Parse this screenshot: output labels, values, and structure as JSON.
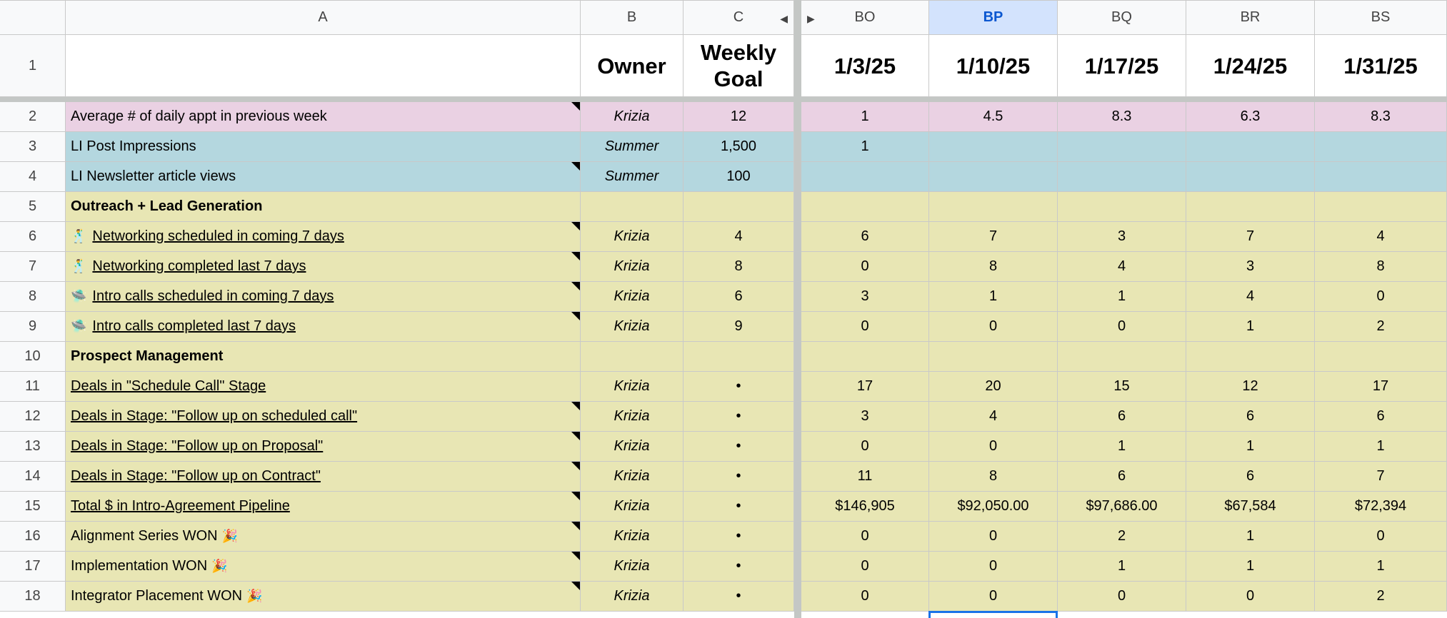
{
  "columns": {
    "row_header": "",
    "A": "A",
    "B": "B",
    "C": "C",
    "BO": "BO",
    "BP": "BP",
    "BQ": "BQ",
    "BR": "BR",
    "BS": "BS"
  },
  "header_row": {
    "num": "1",
    "owner": "Owner",
    "goal": "Weekly Goal",
    "dates": [
      "1/3/25",
      "1/10/25",
      "1/17/25",
      "1/24/25",
      "1/31/25"
    ]
  },
  "icons": {
    "networking": "🕺",
    "intro_call": "🛸",
    "won": "🎉"
  },
  "rows": [
    {
      "num": "2",
      "label": "Average # of daily appt in previous week",
      "owner": "Krizia",
      "goal": "12",
      "values": [
        "1",
        "4.5",
        "8.3",
        "6.3",
        "8.3"
      ]
    },
    {
      "num": "3",
      "label": "LI Post Impressions",
      "owner": "Summer",
      "goal": "1,500",
      "values": [
        "1",
        "",
        "",
        "",
        ""
      ]
    },
    {
      "num": "4",
      "label": "LI Newsletter article views",
      "owner": "Summer",
      "goal": "100",
      "values": [
        "",
        "",
        "",
        "",
        ""
      ]
    },
    {
      "num": "5",
      "label": "Outreach + Lead Generation",
      "owner": "",
      "goal": "",
      "values": [
        "",
        "",
        "",
        "",
        ""
      ]
    },
    {
      "num": "6",
      "label": "Networking scheduled in coming 7 days",
      "owner": "Krizia",
      "goal": "4",
      "values": [
        "6",
        "7",
        "3",
        "7",
        "4"
      ]
    },
    {
      "num": "7",
      "label": "Networking completed last 7 days",
      "owner": "Krizia",
      "goal": "8",
      "values": [
        "0",
        "8",
        "4",
        "3",
        "8"
      ]
    },
    {
      "num": "8",
      "label": "Intro calls scheduled in coming 7 days",
      "owner": "Krizia",
      "goal": "6",
      "values": [
        "3",
        "1",
        "1",
        "4",
        "0"
      ]
    },
    {
      "num": "9",
      "label": "Intro calls completed last 7 days",
      "owner": "Krizia",
      "goal": "9",
      "values": [
        "0",
        "0",
        "0",
        "1",
        "2"
      ]
    },
    {
      "num": "10",
      "label": "Prospect Management",
      "owner": "",
      "goal": "",
      "values": [
        "",
        "",
        "",
        "",
        ""
      ]
    },
    {
      "num": "11",
      "label": "Deals in \"Schedule Call\" Stage",
      "owner": "Krizia",
      "goal": "•",
      "values": [
        "17",
        "20",
        "15",
        "12",
        "17"
      ]
    },
    {
      "num": "12",
      "label": "Deals in Stage: \"Follow up on scheduled call\"",
      "owner": "Krizia",
      "goal": "•",
      "values": [
        "3",
        "4",
        "6",
        "6",
        "6"
      ]
    },
    {
      "num": "13",
      "label": "Deals in Stage: \"Follow up on Proposal\"",
      "owner": "Krizia",
      "goal": "•",
      "values": [
        "0",
        "0",
        "1",
        "1",
        "1"
      ]
    },
    {
      "num": "14",
      "label": "Deals in Stage: \"Follow up on Contract\"",
      "owner": "Krizia",
      "goal": "•",
      "values": [
        "11",
        "8",
        "6",
        "6",
        "7"
      ]
    },
    {
      "num": "15",
      "label": "Total $ in Intro-Agreement Pipeline",
      "owner": "Krizia",
      "goal": "•",
      "values": [
        "$146,905",
        "$92,050.00",
        "$97,686.00",
        "$67,584",
        "$72,394"
      ]
    },
    {
      "num": "16",
      "label": "Alignment Series WON",
      "owner": "Krizia",
      "goal": "•",
      "values": [
        "0",
        "0",
        "2",
        "1",
        "0"
      ]
    },
    {
      "num": "17",
      "label": "Implementation WON",
      "owner": "Krizia",
      "goal": "•",
      "values": [
        "0",
        "0",
        "1",
        "1",
        "1"
      ]
    },
    {
      "num": "18",
      "label": "Integrator Placement WON",
      "owner": "Krizia",
      "goal": "•",
      "values": [
        "0",
        "0",
        "0",
        "0",
        "2"
      ]
    }
  ]
}
